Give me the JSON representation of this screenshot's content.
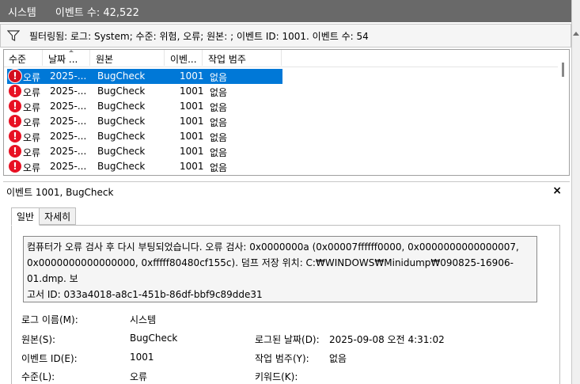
{
  "titlebar": {
    "log_name": "시스템",
    "event_count": "이벤트 수: 42,522"
  },
  "filter": {
    "text": "필터링됨: 로그: System; 수준: 위험, 오류; 원본: ; 이벤트 ID: 1001. 이벤트 수: 54"
  },
  "columns": {
    "level": "수준",
    "date": "날짜 ...",
    "source": "원본",
    "event_id": "이벤...",
    "category": "작업 범주"
  },
  "rows": [
    {
      "level": "오류",
      "date": "2025-...",
      "source": "BugCheck",
      "event_id": "1001",
      "category": "없음",
      "selected": true
    },
    {
      "level": "오류",
      "date": "2025-...",
      "source": "BugCheck",
      "event_id": "1001",
      "category": "없음"
    },
    {
      "level": "오류",
      "date": "2025-...",
      "source": "BugCheck",
      "event_id": "1001",
      "category": "없음"
    },
    {
      "level": "오류",
      "date": "2025-...",
      "source": "BugCheck",
      "event_id": "1001",
      "category": "없음"
    },
    {
      "level": "오류",
      "date": "2025-...",
      "source": "BugCheck",
      "event_id": "1001",
      "category": "없음"
    },
    {
      "level": "오류",
      "date": "2025-...",
      "source": "BugCheck",
      "event_id": "1001",
      "category": "없음"
    },
    {
      "level": "오류",
      "date": "2025-...",
      "source": "BugCheck",
      "event_id": "1001",
      "category": "없음"
    }
  ],
  "detail": {
    "header": "이벤트 1001, BugCheck",
    "close": "×",
    "tabs": [
      "일반",
      "자세히"
    ],
    "description_lines": [
      "컴퓨터가 오류 검사 후 다시 부팅되었습니다. 오류 검사: 0x0000000a (0x00007ffffff0000, 0x0000000000000007,",
      "0x0000000000000000, 0xfffff80480cf155c). 덤프 저장 위치: C:₩WINDOWS₩Minidump₩090825-16906-01.dmp. 보",
      "고서 ID: 033a4018-a8c1-451b-86df-bbf9c89dde31"
    ],
    "fields": {
      "log_name_label": "로그 이름(M):",
      "log_name_value": "시스템",
      "source_label": "원본(S):",
      "source_value": "BugCheck",
      "logged_label": "로그된 날짜(D):",
      "logged_value": "2025-09-08 오전 4:31:02",
      "event_id_label": "이벤트 ID(E):",
      "event_id_value": "1001",
      "category_label": "작업 범주(Y):",
      "category_value": "없음",
      "level_label": "수준(L):",
      "level_value": "오류",
      "keywords_label": "키워드(K):"
    }
  },
  "colors": {
    "titlebar": "#696969",
    "selection": "#0078d7",
    "error_icon": "#e81123"
  },
  "icons": {
    "filter": "funnel-icon",
    "error": "error-icon",
    "close": "close-icon"
  }
}
